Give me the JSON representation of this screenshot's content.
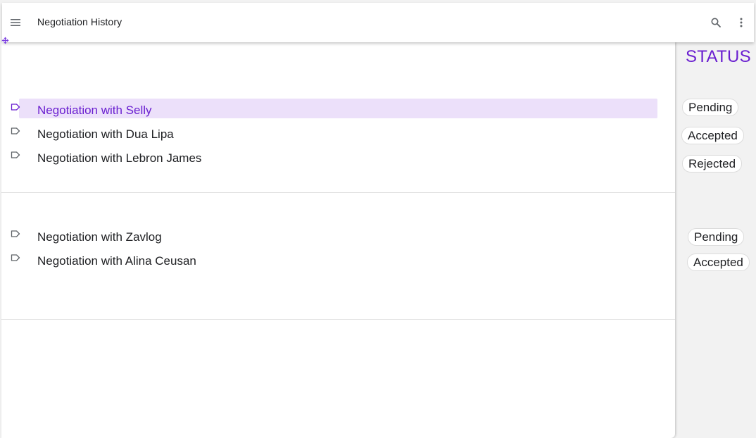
{
  "appbar": {
    "title": "Negotiation History",
    "menu_icon": "hamburger-menu-icon",
    "search_icon": "search-icon",
    "more_icon": "more-vert-icon"
  },
  "colors": {
    "accent": "#6a1fd0",
    "selected_row_bg": "#ece0fa"
  },
  "groups": [
    {
      "items": [
        {
          "label": "Negotiation with Selly",
          "status": "Pending",
          "selected": true
        },
        {
          "label": "Negotiation with Dua Lipa",
          "status": "Accepted",
          "selected": false
        },
        {
          "label": "Negotiation with Lebron James",
          "status": "Rejected",
          "selected": false
        }
      ]
    },
    {
      "items": [
        {
          "label": "Negotiation with Zavlog",
          "status": "Pending",
          "selected": false
        },
        {
          "label": "Negotiation with Alina Ceusan",
          "status": "Accepted",
          "selected": false
        }
      ]
    }
  ],
  "status_column": {
    "heading": "STATUS"
  }
}
